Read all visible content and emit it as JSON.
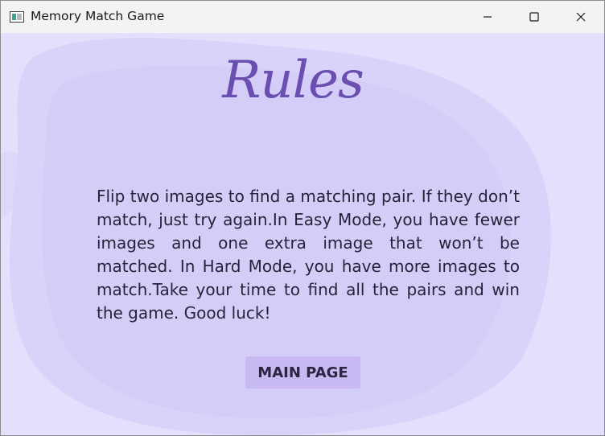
{
  "window": {
    "title": "Memory Match Game",
    "controls": {
      "minimize_icon": "minimize-icon",
      "maximize_icon": "maximize-icon",
      "close_icon": "close-icon"
    }
  },
  "page": {
    "heading": "Rules",
    "rules_text": "Flip two images to find a matching pair. If they don’t match, just try again.In Easy Mode, you have fewer images and one extra image that won’t be matched. In Hard Mode, you have more images to match.Take your time to find all the pairs and win the game. Good luck!",
    "main_page_button": "MAIN PAGE"
  },
  "colors": {
    "background": "#e5defc",
    "watercolor_blob": "#d6cff7",
    "heading": "#6a4fb0",
    "body_text": "#26233a",
    "button_bg": "#c9b9f2",
    "button_text": "#2b2541"
  }
}
